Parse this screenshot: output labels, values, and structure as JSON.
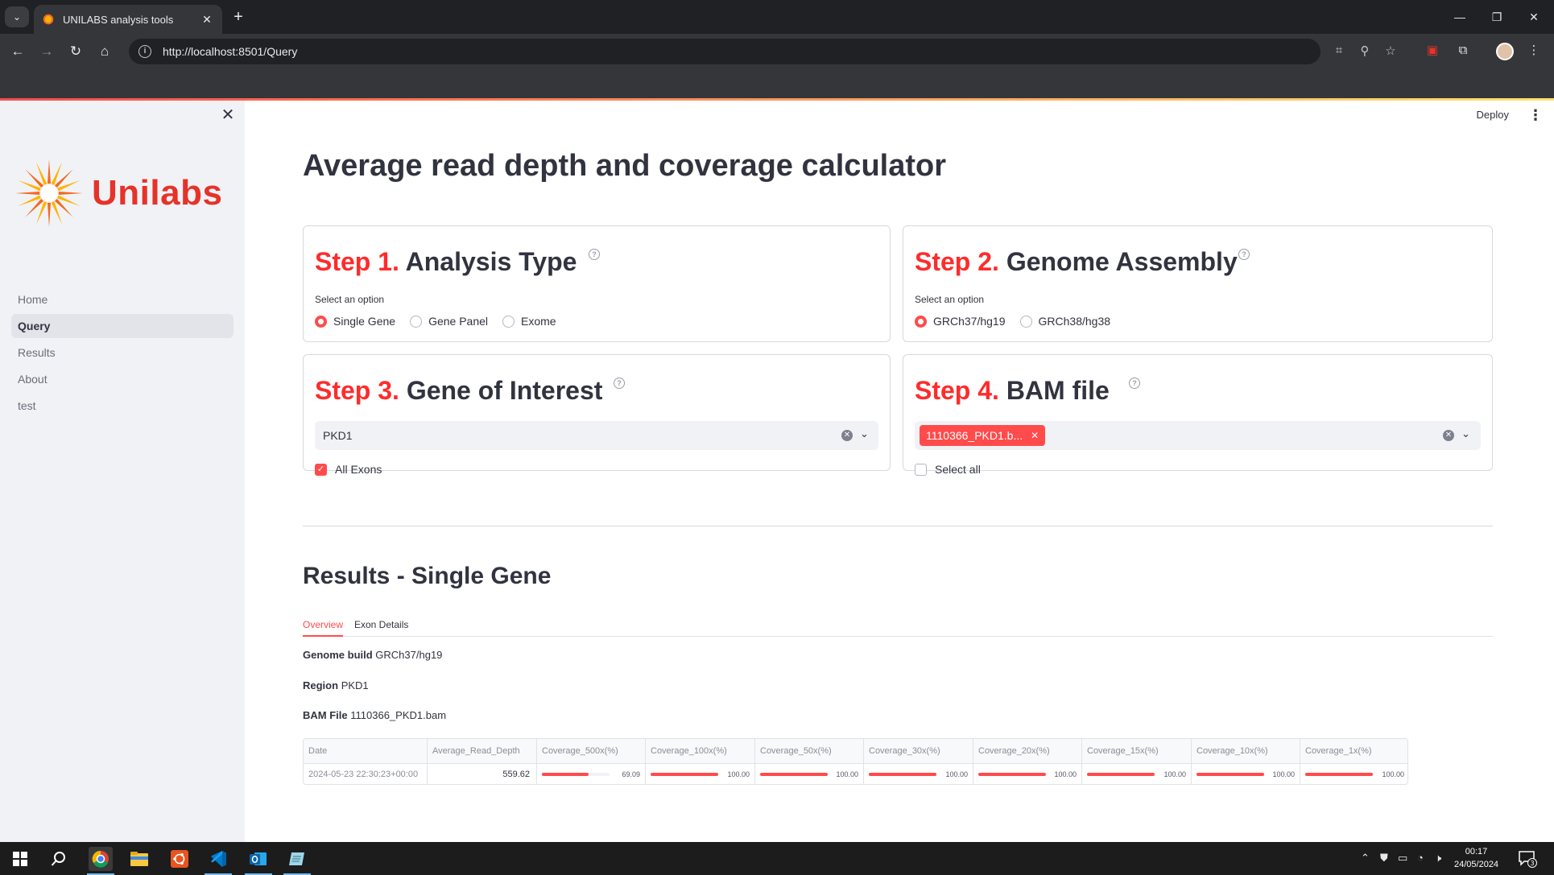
{
  "browser": {
    "tab_title": "UNILABS analysis tools",
    "url": "http://localhost:8501/Query",
    "icons": [
      "tab-dropdown-icon",
      "favicon",
      "close-tab-icon",
      "new-tab-icon",
      "minimize-icon",
      "restore-icon",
      "close-window-icon",
      "back-icon",
      "forward-icon",
      "reload-icon",
      "home-icon",
      "site-info-icon",
      "translate-icon",
      "zoom-icon",
      "bookmark-star-icon",
      "extension-icon",
      "extensions-puzzle-icon",
      "profile-avatar",
      "chrome-menu-icon"
    ]
  },
  "sidebar": {
    "logo_text": "Unilabs",
    "items": [
      {
        "label": "Home",
        "active": false
      },
      {
        "label": "Query",
        "active": true
      },
      {
        "label": "Results",
        "active": false
      },
      {
        "label": "About",
        "active": false
      },
      {
        "label": "test",
        "active": false
      }
    ]
  },
  "header": {
    "deploy_label": "Deploy"
  },
  "main": {
    "title": "Average read depth and coverage calculator",
    "step1": {
      "step": "Step 1.",
      "title": "Analysis Type",
      "option_label": "Select an option",
      "options": [
        {
          "label": "Single Gene",
          "selected": true
        },
        {
          "label": "Gene Panel",
          "selected": false
        },
        {
          "label": "Exome",
          "selected": false
        }
      ]
    },
    "step2": {
      "step": "Step 2.",
      "title": "Genome Assembly",
      "option_label": "Select an option",
      "options": [
        {
          "label": "GRCh37/hg19",
          "selected": true
        },
        {
          "label": "GRCh38/hg38",
          "selected": false
        }
      ]
    },
    "step3": {
      "step": "Step 3.",
      "title": "Gene of Interest",
      "select_value": "PKD1",
      "checkbox_label": "All Exons",
      "checkbox_checked": true
    },
    "step4": {
      "step": "Step 4.",
      "title": "BAM file",
      "chip_label": "1110366_PKD1.b...",
      "checkbox_label": "Select all",
      "checkbox_checked": false
    },
    "results": {
      "title": "Results - Single Gene",
      "tabs": [
        {
          "label": "Overview",
          "active": true
        },
        {
          "label": "Exon Details",
          "active": false
        }
      ],
      "genome_build_label": "Genome build",
      "genome_build_value": "GRCh37/hg19",
      "region_label": "Region",
      "region_value": "PKD1",
      "bam_label": "BAM File",
      "bam_value": "1110366_PKD1.bam",
      "table": {
        "columns": [
          "Date",
          "Average_Read_Depth",
          "Coverage_500x(%)",
          "Coverage_100x(%)",
          "Coverage_50x(%)",
          "Coverage_30x(%)",
          "Coverage_20x(%)",
          "Coverage_15x(%)",
          "Coverage_10x(%)",
          "Coverage_1x(%)"
        ],
        "row": {
          "date": "2024-05-23 22:30:23+00:00",
          "avg_depth": "559.62",
          "coverage": [
            "69.09",
            "100.00",
            "100.00",
            "100.00",
            "100.00",
            "100.00",
            "100.00",
            "100.00"
          ]
        }
      }
    }
  },
  "taskbar": {
    "time": "00:17",
    "date": "24/05/2024",
    "notification_count": "3",
    "icons": [
      "windows-start-icon",
      "search-icon",
      "chrome-icon",
      "file-explorer-icon",
      "ubuntu-icon",
      "vscode-icon",
      "outlook-icon",
      "notepad-icon",
      "show-hidden-icons-icon",
      "defender-icon",
      "devices-icon",
      "network-icon",
      "volume-icon",
      "notification-icon"
    ]
  },
  "colors": {
    "accent": "#ff4b4b",
    "brand": "#e63329",
    "sidebar_bg": "#f0f2f6"
  }
}
